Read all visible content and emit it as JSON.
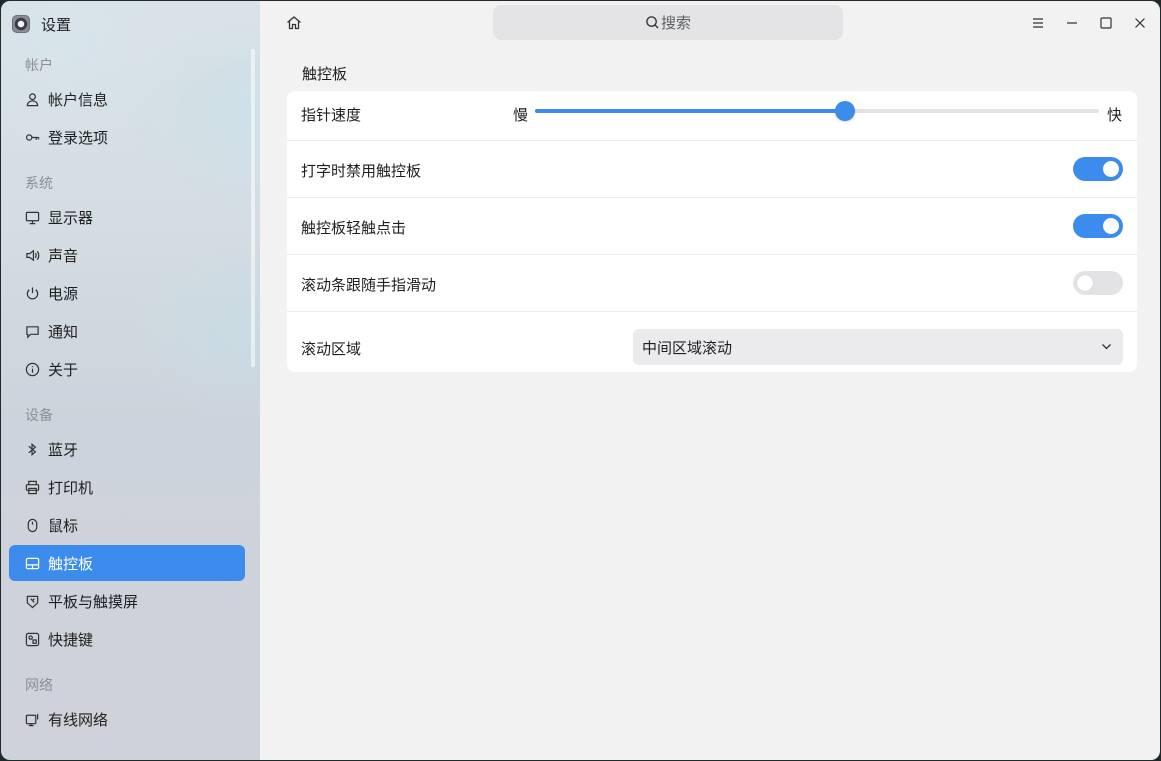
{
  "app": {
    "title": "设置"
  },
  "sidebar": {
    "sections": [
      {
        "title": "帐户",
        "items": [
          {
            "label": "帐户信息",
            "icon": "user-icon"
          },
          {
            "label": "登录选项",
            "icon": "key-icon"
          }
        ]
      },
      {
        "title": "系统",
        "items": [
          {
            "label": "显示器",
            "icon": "monitor-icon"
          },
          {
            "label": "声音",
            "icon": "speaker-icon"
          },
          {
            "label": "电源",
            "icon": "power-icon"
          },
          {
            "label": "通知",
            "icon": "notification-icon"
          },
          {
            "label": "关于",
            "icon": "info-icon"
          }
        ]
      },
      {
        "title": "设备",
        "items": [
          {
            "label": "蓝牙",
            "icon": "bluetooth-icon"
          },
          {
            "label": "打印机",
            "icon": "printer-icon"
          },
          {
            "label": "鼠标",
            "icon": "mouse-icon"
          },
          {
            "label": "触控板",
            "icon": "touchpad-icon",
            "active": true
          },
          {
            "label": "平板与触摸屏",
            "icon": "tablet-icon"
          },
          {
            "label": "快捷键",
            "icon": "shortcut-icon"
          }
        ]
      },
      {
        "title": "网络",
        "items": [
          {
            "label": "有线网络",
            "icon": "wired-network-icon"
          }
        ]
      }
    ]
  },
  "search": {
    "placeholder": "搜索"
  },
  "page": {
    "title": "触控板",
    "pointer_speed": {
      "label": "指针速度",
      "min_label": "慢",
      "max_label": "快",
      "value": 0.55
    },
    "disable_while_typing": {
      "label": "打字时禁用触控板",
      "on": true
    },
    "tap_to_click": {
      "label": "触控板轻触点击",
      "on": true
    },
    "natural_scroll": {
      "label": "滚动条跟随手指滑动",
      "on": false
    },
    "scroll_area": {
      "label": "滚动区域",
      "value": "中间区域滚动"
    }
  },
  "colors": {
    "accent": "#3b8ced",
    "main_bg": "#f2f2f3",
    "card_bg": "#ffffff"
  }
}
